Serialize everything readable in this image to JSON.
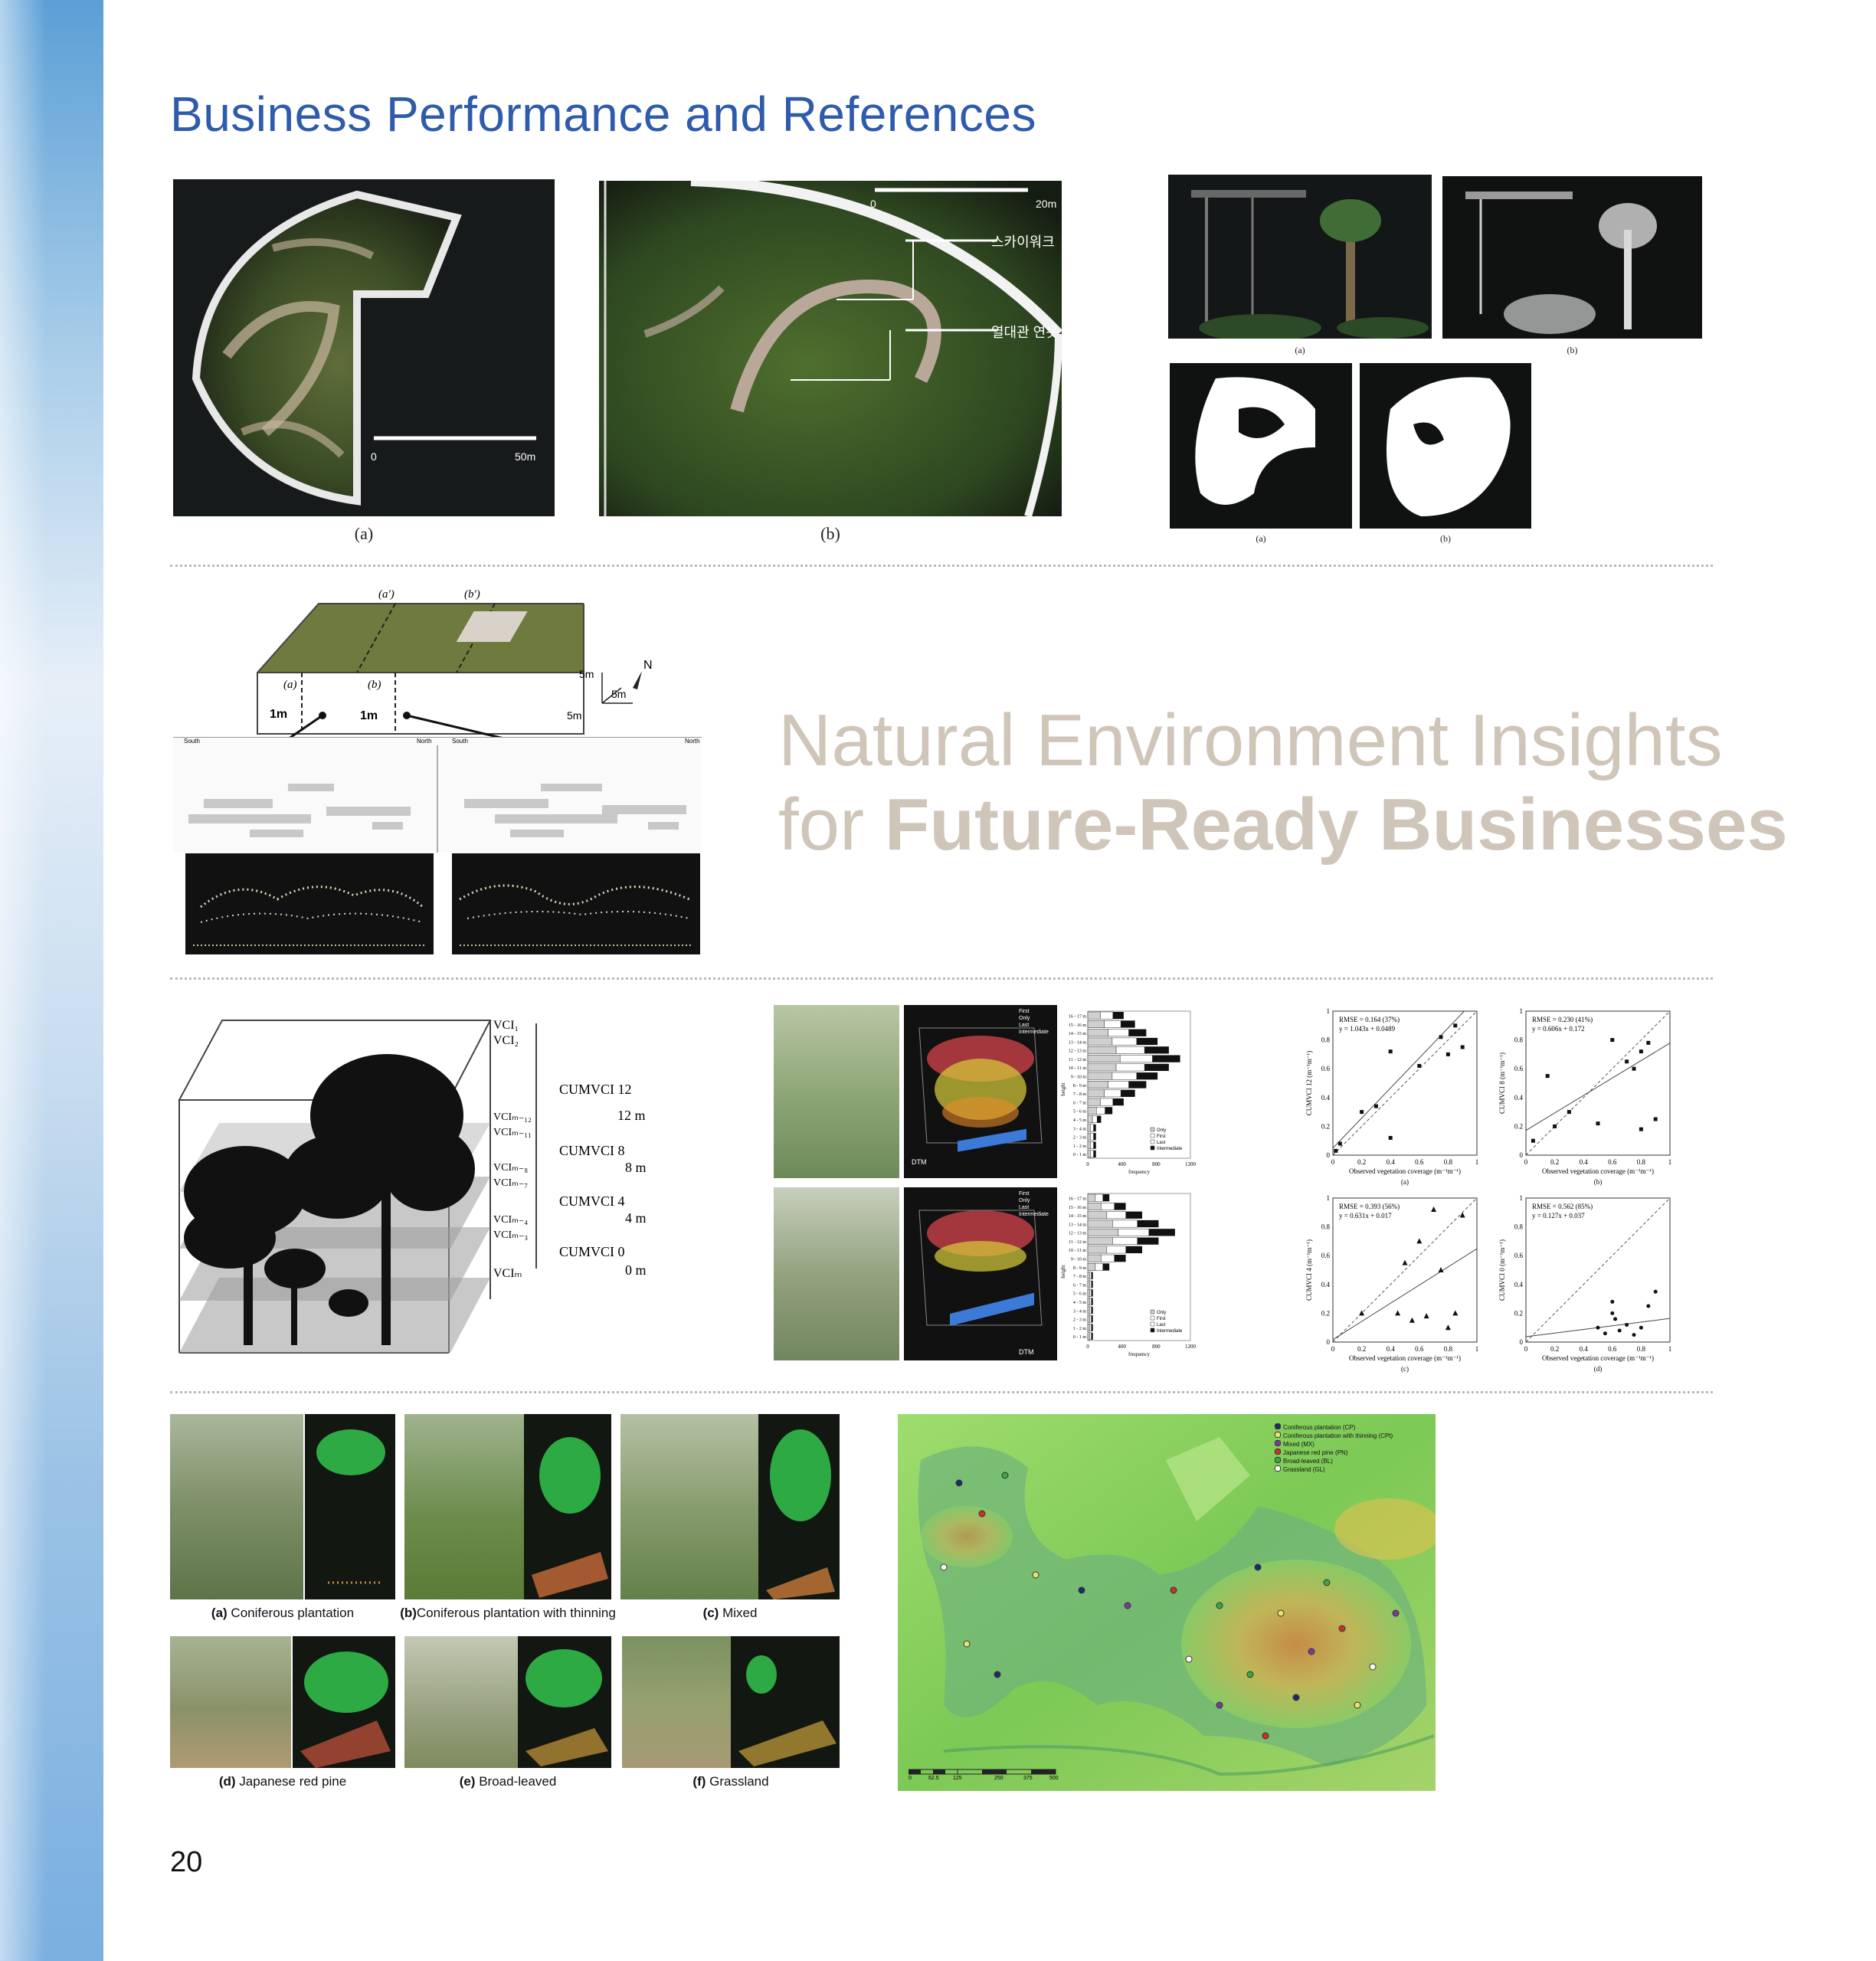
{
  "page": {
    "title": "Business Performance and References",
    "page_number": "20"
  },
  "row1": {
    "fig1": {
      "caption": "(a)",
      "scale_start": "0",
      "scale_end": "50m"
    },
    "fig2": {
      "caption": "(b)",
      "scale_start": "0",
      "scale_end": "20m",
      "label_skywalk": "스카이워크",
      "label_pond": "열대관 연못"
    },
    "fig3": {
      "cap_a_top": "(a)",
      "cap_b_top": "(b)",
      "cap_a_bottom": "(a)",
      "cap_b_bottom": "(b)"
    }
  },
  "row2": {
    "diagram": {
      "label_a_prime": "(a')",
      "label_b_prime": "(b')",
      "label_a": "(a)",
      "label_b": "(b)",
      "label_1m_left": "1m",
      "label_1m_right": "1m",
      "label_5m_a": "5m",
      "label_5m_b": "5m",
      "label_5m_c": "5m",
      "north": "N",
      "south": "South",
      "north_word": "North"
    },
    "headline_line1": "Natural Environment Insights",
    "headline_line2_regular": "for ",
    "headline_line2_bold": "Future-Ready Businesses"
  },
  "row3": {
    "vci": {
      "labels": [
        "VCI₁",
        "VCI₂",
        "VCIₘ₋₁₂",
        "VCIₘ₋₁₁",
        "VCIₘ₋₈",
        "VCIₘ₋₇",
        "VCIₘ₋₄",
        "VCIₘ₋₃",
        "VCIₘ"
      ],
      "layers": [
        {
          "name": "CUMVCI 12",
          "height": "12 m"
        },
        {
          "name": "CUMVCI 8",
          "height": "8 m"
        },
        {
          "name": "CUMVCI 4",
          "height": "4 m"
        },
        {
          "name": "CUMVCI 0",
          "height": "0 m"
        }
      ]
    },
    "histogram": {
      "y_categories": [
        "16 - 17 m",
        "15 - 16 m",
        "14 - 15 m",
        "13 - 14 m",
        "12 - 13 m",
        "11 - 12 m",
        "10 - 11 m",
        "9 - 10 m",
        "8 - 9 m",
        "7 - 8 m",
        "6 - 7 m",
        "5 - 6 m",
        "4 - 5 m",
        "3 - 4 m",
        "2 - 3 m",
        "1 - 2 m",
        "0 - 1 m"
      ],
      "x_ticks": [
        "0",
        "400",
        "800",
        "1200"
      ],
      "xlabel": "frequency",
      "ylabel": "height",
      "legend": [
        "Only",
        "First",
        "Last",
        "Intermediate"
      ],
      "legend_3d": [
        "First",
        "Only",
        "Last",
        "Intermediate"
      ],
      "dtm": "DTM"
    },
    "scatter": {
      "xlabel": "Observed vegetation coverage (m⁻¹m⁻¹)",
      "x_ticks": [
        "0",
        "0.2",
        "0.4",
        "0.6",
        "0.8",
        "1"
      ],
      "y_ticks": [
        "0",
        "0.2",
        "0.4",
        "0.6",
        "0.8",
        "1"
      ],
      "panels": [
        {
          "caption": "(a)",
          "ylabel": "CUMVCI 12 (m⁻¹m⁻¹)",
          "rmse": "RMSE = 0.164 (37%)",
          "eq": "y = 1.043x + 0.0489"
        },
        {
          "caption": "(b)",
          "ylabel": "CUMVCI 8 (m⁻¹m⁻¹)",
          "rmse": "RMSE = 0.230 (41%)",
          "eq": "y = 0.606x + 0.172"
        },
        {
          "caption": "(c)",
          "ylabel": "CUMVCI 4 (m⁻¹m⁻¹)",
          "rmse": "RMSE = 0.393 (56%)",
          "eq": "y = 0.631x + 0.017"
        },
        {
          "caption": "(d)",
          "ylabel": "CUMVCI 0 (m⁻¹m⁻¹)",
          "rmse": "RMSE = 0.562 (85%)",
          "eq": "y = 0.127x + 0.037"
        }
      ]
    }
  },
  "row4": {
    "photo_captions": [
      {
        "letter": "(a)",
        "text": " Coniferous plantation"
      },
      {
        "letter": "(b)",
        "text": "Coniferous plantation with thinning"
      },
      {
        "letter": "(c)",
        "text": " Mixed"
      },
      {
        "letter": "(d)",
        "text": " Japanese red pine"
      },
      {
        "letter": "(e)",
        "text": " Broad-leaved"
      },
      {
        "letter": "(f)",
        "text": " Grassland"
      }
    ],
    "map_legend": [
      {
        "label": "Coniferous plantation (CP)",
        "color": "#1d2b6e"
      },
      {
        "label": "Coniferous plantation with thinning (CPt)",
        "color": "#e9e36a"
      },
      {
        "label": "Mixed (MX)",
        "color": "#7a3a9a"
      },
      {
        "label": "Japanese red pine (PN)",
        "color": "#c9312b"
      },
      {
        "label": "Broad-leaved (BL)",
        "color": "#3aa845"
      },
      {
        "label": "Grassland (GL)",
        "color": "#ffffff"
      }
    ],
    "map_scale": [
      "0",
      "62.5",
      "125",
      "250",
      "375",
      "500"
    ]
  }
}
